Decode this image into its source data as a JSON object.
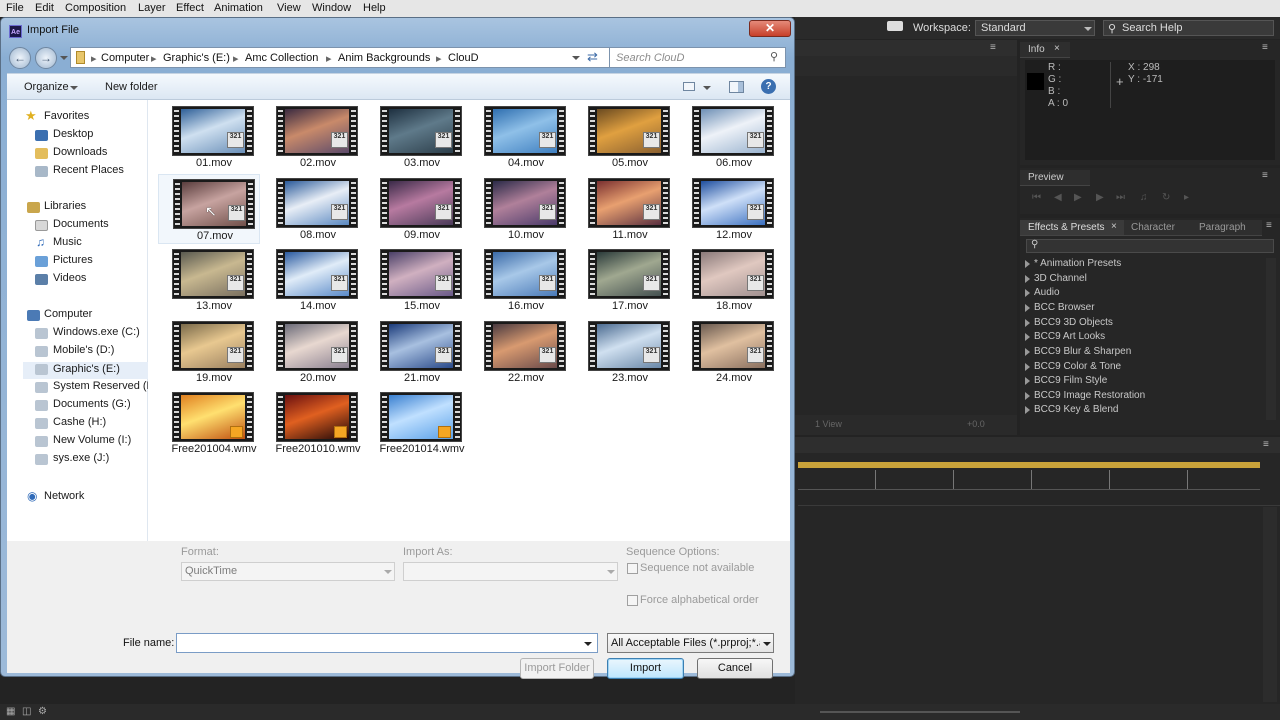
{
  "menu": [
    "File",
    "Edit",
    "Composition",
    "Layer",
    "Effect",
    "Animation",
    "View",
    "Window",
    "Help"
  ],
  "workspace": {
    "label": "Workspace:",
    "value": "Standard",
    "search_placeholder": "Search Help"
  },
  "info": {
    "tab": "Info",
    "r": "R :",
    "g": "G :",
    "b": "B :",
    "a": "A : 0",
    "x": "X : 298",
    "y": "Y : -171"
  },
  "preview": {
    "tab": "Preview"
  },
  "effects": {
    "tab": "Effects & Presets",
    "tab2": "Character",
    "tab3": "Paragraph",
    "items": [
      "* Animation Presets",
      "3D Channel",
      "Audio",
      "BCC Browser",
      "BCC9 3D Objects",
      "BCC9 Art Looks",
      "BCC9 Blur & Sharpen",
      "BCC9 Color & Tone",
      "BCC9 Film Style",
      "BCC9 Image Restoration",
      "BCC9 Key & Blend"
    ]
  },
  "comp": {
    "view_label": "1 View",
    "offset": "+0.0"
  },
  "dialog": {
    "title": "Import File",
    "logo": "Ae",
    "breadcrumb": [
      "Computer",
      "Graphic's (E:)",
      "Amc Collection",
      "Anim Backgrounds",
      "ClouD"
    ],
    "search_placeholder": "Search ClouD",
    "organize": "Organize",
    "new_folder": "New folder",
    "nav": {
      "favorites": "Favorites",
      "fav_items": [
        "Desktop",
        "Downloads",
        "Recent Places"
      ],
      "libraries": "Libraries",
      "lib_items": [
        "Documents",
        "Music",
        "Pictures",
        "Videos"
      ],
      "computer": "Computer",
      "drives": [
        "Windows.exe (C:)",
        "Mobile's (D:)",
        "Graphic's (E:)",
        "System Reserved (F:)",
        "Documents (G:)",
        "Cashe (H:)",
        "New Volume (I:)",
        "sys.exe (J:)"
      ],
      "network": "Network"
    },
    "files": [
      "01.mov",
      "02.mov",
      "03.mov",
      "04.mov",
      "05.mov",
      "06.mov",
      "07.mov",
      "08.mov",
      "09.mov",
      "10.mov",
      "11.mov",
      "12.mov",
      "13.mov",
      "14.mov",
      "15.mov",
      "16.mov",
      "17.mov",
      "18.mov",
      "19.mov",
      "20.mov",
      "21.mov",
      "22.mov",
      "23.mov",
      "24.mov",
      "Free201004.wmv",
      "Free201010.wmv",
      "Free201014.wmv"
    ],
    "badge": "321",
    "format_label": "Format:",
    "format_value": "QuickTime",
    "import_as_label": "Import As:",
    "import_as_value": "",
    "seq_label": "Sequence Options:",
    "seq_check": "Sequence not available",
    "alpha_check": "Force alphabetical order",
    "filename_label": "File name:",
    "filename_value": "",
    "filter": "All Acceptable Files (*.prproj;*.a",
    "import_folder": "Import Folder",
    "import": "Import",
    "cancel": "Cancel"
  },
  "colors": {
    "accent": "#c9a23a",
    "dialog_frame": "#8aaed3"
  }
}
